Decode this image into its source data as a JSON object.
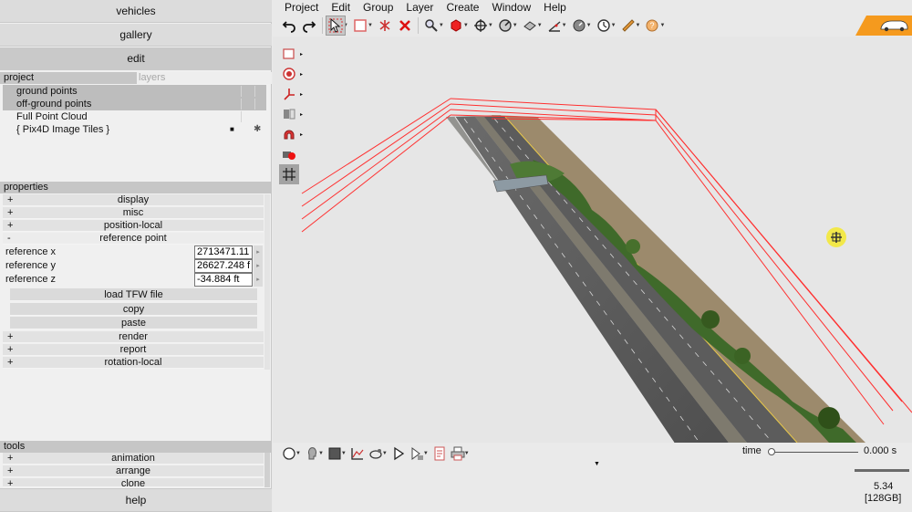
{
  "left_panel": {
    "top_buttons": [
      {
        "label": "vehicles"
      },
      {
        "label": "gallery"
      },
      {
        "label": "edit"
      }
    ],
    "project_tab": "project",
    "layers_tab": "layers",
    "layers": [
      {
        "label": "ground points"
      },
      {
        "label": "off-ground points"
      },
      {
        "label": "Full Point Cloud"
      },
      {
        "label": "{ Pix4D Image Tiles }"
      }
    ],
    "properties_header": "properties",
    "properties": [
      {
        "sign": "+",
        "label": "display"
      },
      {
        "sign": "+",
        "label": "misc"
      },
      {
        "sign": "+",
        "label": "position-local"
      },
      {
        "sign": "-",
        "label": "reference point"
      }
    ],
    "reference": {
      "x_label": "reference x",
      "x_value": "2713471.11",
      "y_label": "reference y",
      "y_value": "26627.248 f",
      "z_label": "reference z",
      "z_value": "-34.884 ft"
    },
    "actions": [
      {
        "label": "load TFW file"
      },
      {
        "label": "copy"
      },
      {
        "label": "paste"
      }
    ],
    "properties_more": [
      {
        "sign": "+",
        "label": "render"
      },
      {
        "sign": "+",
        "label": "report"
      },
      {
        "sign": "+",
        "label": "rotation-local"
      }
    ],
    "tools_header": "tools",
    "tools": [
      {
        "sign": "+",
        "label": "animation"
      },
      {
        "sign": "+",
        "label": "arrange"
      },
      {
        "sign": "+",
        "label": "clone"
      }
    ],
    "help_label": "help"
  },
  "menu": [
    "Project",
    "Edit",
    "Group",
    "Layer",
    "Create",
    "Window",
    "Help"
  ],
  "bottom": {
    "time_label": "time",
    "time_value": "0.000 s",
    "fps": "5.34",
    "memory": "[128GB]"
  },
  "colors": {
    "bounding_box": "#ff3030",
    "road": "#5a5a5a",
    "vegetation": "#3f6a2a",
    "corner_badge": "#f59a1e",
    "gizmo": "#f2e84a"
  }
}
